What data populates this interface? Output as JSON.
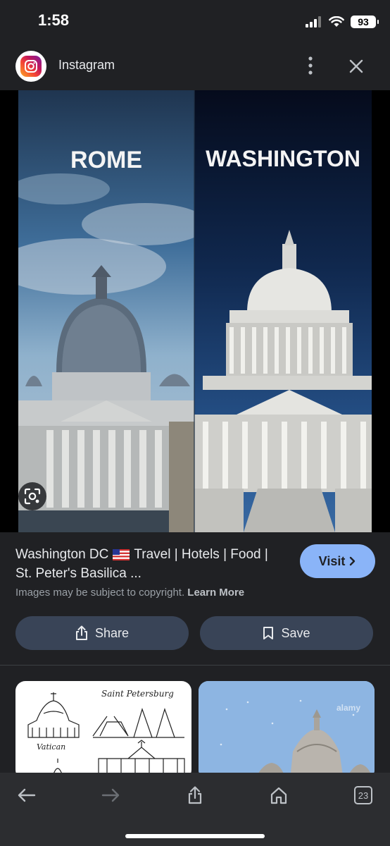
{
  "status_bar": {
    "time": "1:58",
    "battery": "93"
  },
  "header": {
    "app_name": "Instagram",
    "more_icon": "more-vert-icon",
    "close_icon": "close-icon"
  },
  "image": {
    "left_label": "ROME",
    "right_label": "WASHINGTON",
    "lens_icon": "lens-search-icon"
  },
  "result": {
    "title_part1": "Washington DC",
    "title_part2": "Travel | Hotels | Food | St. Peter's Basilica ...",
    "visit_label": "Visit",
    "copyright_text": "Images may be subject to copyright.",
    "learn_more": "Learn More",
    "share_label": "Share",
    "save_label": "Save"
  },
  "related": {
    "card1_texts": [
      "Saint Petersburg",
      "Vatican"
    ],
    "card2_watermark": "alamy"
  },
  "bottom_nav": {
    "tab_count": "23"
  },
  "colors": {
    "accent": "#8ab4f8",
    "background": "#202124",
    "button": "#394457"
  }
}
